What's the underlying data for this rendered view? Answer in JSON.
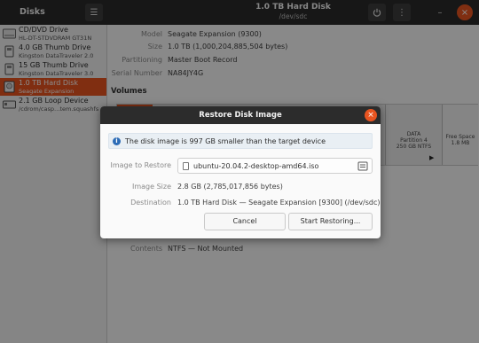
{
  "header": {
    "app_title": "Disks",
    "disk_title": "1.0 TB Hard Disk",
    "disk_path": "/dev/sdc"
  },
  "sidebar": {
    "devices": [
      {
        "name": "CD/DVD Drive",
        "detail": "HL-DT-STDVDRAM GT31N",
        "icon": "optical-drive-icon"
      },
      {
        "name": "4.0 GB Thumb Drive",
        "detail": "Kingston DataTraveler 2.0",
        "icon": "usb-drive-icon"
      },
      {
        "name": "15 GB Thumb Drive",
        "detail": "Kingston DataTraveler 3.0",
        "icon": "usb-drive-icon"
      },
      {
        "name": "1.0 TB Hard Disk",
        "detail": "Seagate Expansion",
        "icon": "hard-disk-icon",
        "selected": true
      },
      {
        "name": "2.1 GB Loop Device",
        "detail": "/cdrom/casp…tem.squashfs",
        "icon": "loop-device-icon"
      }
    ]
  },
  "drive": {
    "model_label": "Model",
    "model": "Seagate Expansion (9300)",
    "size_label": "Size",
    "size": "1.0 TB (1,000,204,885,504 bytes)",
    "partitioning_label": "Partitioning",
    "partitioning": "Master Boot Record",
    "serial_label": "Serial Number",
    "serial": "NA84JY4G"
  },
  "volumes": {
    "title": "Volumes",
    "partition_name": "DATA",
    "partition_number": "Partition 4",
    "partition_fs": "250 GB NTFS",
    "free_label": "Free Space",
    "free_size": "1.8 MB",
    "contents_label": "Contents",
    "contents": "NTFS — Not Mounted"
  },
  "dialog": {
    "title": "Restore Disk Image",
    "info": "The disk image is 997 GB smaller than the target device",
    "image_label": "Image to Restore",
    "image_file": "ubuntu-20.04.2-desktop-amd64.iso",
    "size_label": "Image Size",
    "size": "2.8 GB (2,785,017,856 bytes)",
    "dest_label": "Destination",
    "dest": "1.0 TB Hard Disk — Seagate Expansion [9300] (/dev/sdc)",
    "cancel": "Cancel",
    "start": "Start Restoring..."
  },
  "colors": {
    "accent": "#e95420",
    "header_bg": "#2b2b2b",
    "info_icon": "#2d6cb6"
  }
}
